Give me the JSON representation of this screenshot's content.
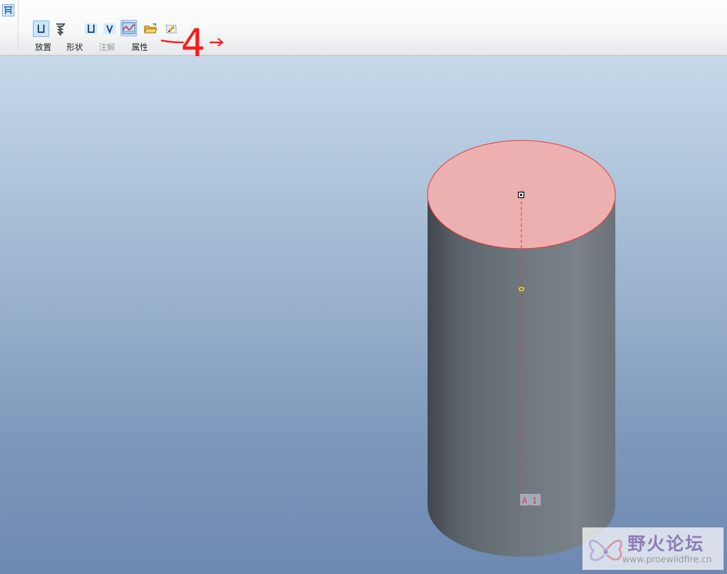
{
  "toolbar": {
    "tabs": [
      {
        "label": "放置",
        "enabled": true
      },
      {
        "label": "形状",
        "enabled": true
      },
      {
        "label": "注解",
        "enabled": false
      },
      {
        "label": "属性",
        "enabled": true
      }
    ],
    "icons": [
      "thread-feature-icon",
      "standard-hole-icon",
      "coil-icon",
      "simple-hole-icon",
      "sketch-hole-icon",
      "profile-hole-icon",
      "open-folder-icon",
      "sketcher-icon"
    ]
  },
  "annotation": {
    "text": "4",
    "color": "#ff1a1a"
  },
  "model": {
    "axis_label": "A_1",
    "top_face_color": "#edb0b0",
    "highlight_color": "#e8343a",
    "body_color": "#70787f"
  },
  "watermark": {
    "title": "野火论坛",
    "url": "www.proewildfire.cn"
  }
}
